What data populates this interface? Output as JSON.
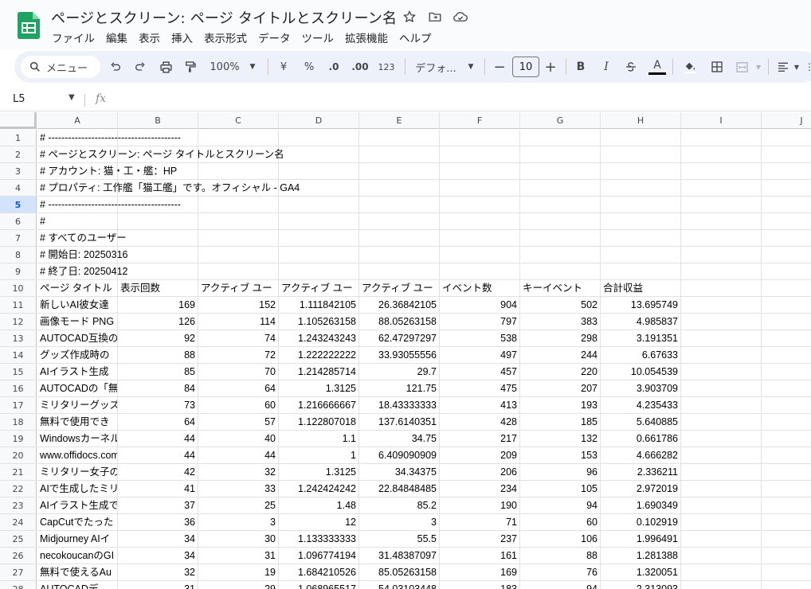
{
  "title_bar": {
    "doc_title": "ページとスクリーン: ページ タイトルとスクリーン名",
    "icons": [
      "star-icon",
      "move-to-folder-icon",
      "cloud-status-icon"
    ]
  },
  "menu": [
    "ファイル",
    "編集",
    "表示",
    "挿入",
    "表示形式",
    "データ",
    "ツール",
    "拡張機能",
    "ヘルプ"
  ],
  "toolbar": {
    "search_label": "メニュー",
    "zoom": "100%",
    "currency": "¥",
    "percent": "%",
    "dec_decrease": ".0",
    "dec_increase": ".00",
    "number_format": "123",
    "font": "デフォ...",
    "font_size": "10",
    "bold": "B",
    "italic": "I",
    "text_color_letter": "A"
  },
  "formula_bar": {
    "name_box": "L5",
    "fx": "fx"
  },
  "grid": {
    "columns": [
      "A",
      "B",
      "C",
      "D",
      "E",
      "F",
      "G",
      "H",
      "I",
      "J"
    ],
    "selected_row": 5,
    "rows": [
      {
        "n": "1",
        "cells": [
          "# ----------------------------------------",
          "",
          "",
          "",
          "",
          "",
          "",
          ""
        ]
      },
      {
        "n": "2",
        "cells": [
          "# ページとスクリーン: ページ タイトルとスクリーン名",
          "",
          "",
          "",
          "",
          "",
          "",
          ""
        ]
      },
      {
        "n": "3",
        "cells": [
          "# アカウント: 猫・工・艦：HP",
          "",
          "",
          "",
          "",
          "",
          "",
          ""
        ]
      },
      {
        "n": "4",
        "cells": [
          "# プロパティ: 工作艦「猫工艦」です。オフィシャル - GA4",
          "",
          "",
          "",
          "",
          "",
          "",
          ""
        ]
      },
      {
        "n": "5",
        "cells": [
          "# ----------------------------------------",
          "",
          "",
          "",
          "",
          "",
          "",
          ""
        ]
      },
      {
        "n": "6",
        "cells": [
          "#",
          "",
          "",
          "",
          "",
          "",
          "",
          ""
        ]
      },
      {
        "n": "7",
        "cells": [
          "# すべてのユーザー",
          "",
          "",
          "",
          "",
          "",
          "",
          ""
        ]
      },
      {
        "n": "8",
        "cells": [
          "# 開始日: 20250316",
          "",
          "",
          "",
          "",
          "",
          "",
          ""
        ]
      },
      {
        "n": "9",
        "cells": [
          "# 終了日: 20250412",
          "",
          "",
          "",
          "",
          "",
          "",
          ""
        ]
      },
      {
        "n": "10",
        "cells": [
          "ページ タイトル",
          "表示回数",
          "アクティブ ユー",
          "アクティブ ユー",
          "アクティブ ユー",
          "イベント数",
          "キーイベント",
          "合計収益"
        ]
      },
      {
        "n": "11",
        "cells": [
          "新しいAI彼女達",
          "169",
          "152",
          "1.111842105",
          "26.36842105",
          "904",
          "502",
          "13.695749"
        ]
      },
      {
        "n": "12",
        "cells": [
          "画像モード PNG",
          "126",
          "114",
          "1.105263158",
          "88.05263158",
          "797",
          "383",
          "4.985837"
        ]
      },
      {
        "n": "13",
        "cells": [
          "AUTOCAD互換の",
          "92",
          "74",
          "1.243243243",
          "62.47297297",
          "538",
          "298",
          "3.191351"
        ]
      },
      {
        "n": "14",
        "cells": [
          "グッズ作成時の",
          "88",
          "72",
          "1.222222222",
          "33.93055556",
          "497",
          "244",
          "6.67633"
        ]
      },
      {
        "n": "15",
        "cells": [
          "AIイラスト生成",
          "85",
          "70",
          "1.214285714",
          "29.7",
          "457",
          "220",
          "10.054539"
        ]
      },
      {
        "n": "16",
        "cells": [
          "AUTOCADの「無",
          "84",
          "64",
          "1.3125",
          "121.75",
          "475",
          "207",
          "3.903709"
        ]
      },
      {
        "n": "17",
        "cells": [
          "ミリタリーグッズ",
          "73",
          "60",
          "1.216666667",
          "18.43333333",
          "413",
          "193",
          "4.235433"
        ]
      },
      {
        "n": "18",
        "cells": [
          "無料で使用でき",
          "64",
          "57",
          "1.122807018",
          "137.6140351",
          "428",
          "185",
          "5.640885"
        ]
      },
      {
        "n": "19",
        "cells": [
          "Windowsカーネル",
          "44",
          "40",
          "1.1",
          "34.75",
          "217",
          "132",
          "0.661786"
        ]
      },
      {
        "n": "20",
        "cells": [
          "www.offidocs.com",
          "44",
          "44",
          "1",
          "6.409090909",
          "209",
          "153",
          "4.666282"
        ]
      },
      {
        "n": "21",
        "cells": [
          "ミリタリー女子の",
          "42",
          "32",
          "1.3125",
          "34.34375",
          "206",
          "96",
          "2.336211"
        ]
      },
      {
        "n": "22",
        "cells": [
          "AIで生成したミリ",
          "41",
          "33",
          "1.242424242",
          "22.84848485",
          "234",
          "105",
          "2.972019"
        ]
      },
      {
        "n": "23",
        "cells": [
          "AIイラスト生成で",
          "37",
          "25",
          "1.48",
          "85.2",
          "190",
          "94",
          "1.690349"
        ]
      },
      {
        "n": "24",
        "cells": [
          "CapCutでたった",
          "36",
          "3",
          "12",
          "3",
          "71",
          "60",
          "0.102919"
        ]
      },
      {
        "n": "25",
        "cells": [
          "Midjourney AIイ",
          "34",
          "30",
          "1.133333333",
          "55.5",
          "237",
          "106",
          "1.996491"
        ]
      },
      {
        "n": "26",
        "cells": [
          "necokoucanのGI",
          "34",
          "31",
          "1.096774194",
          "31.48387097",
          "161",
          "88",
          "1.281388"
        ]
      },
      {
        "n": "27",
        "cells": [
          "無料で使えるAu",
          "32",
          "19",
          "1.684210526",
          "85.05263158",
          "169",
          "76",
          "1.320051"
        ]
      },
      {
        "n": "28",
        "cells": [
          "AUTOCADデ",
          "31",
          "29",
          "1.068965517",
          "54.03103448",
          "183",
          "94",
          "2.313093"
        ]
      }
    ]
  }
}
